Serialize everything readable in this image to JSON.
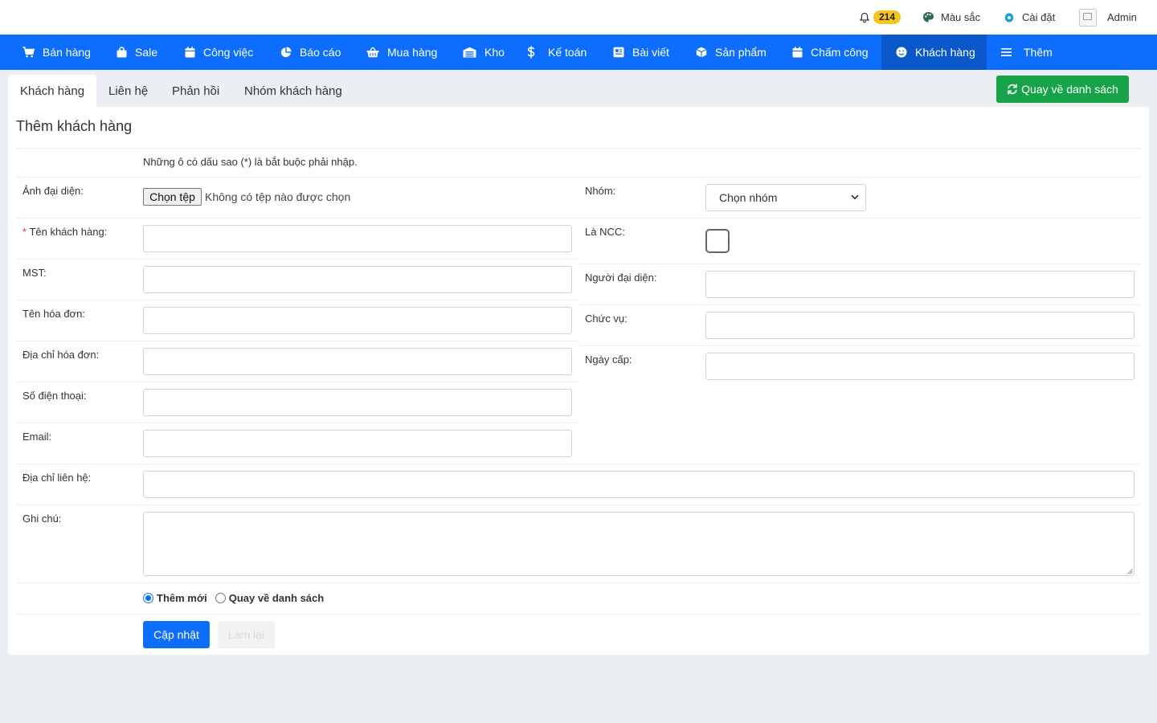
{
  "topbar": {
    "notifications_count": "214",
    "color_label": "Màu sắc",
    "settings_label": "Cài đặt",
    "avatar_alt": "lo",
    "user_name": "Admin"
  },
  "nav": {
    "items": [
      {
        "label": "Bán hàng",
        "icon": "cart-icon"
      },
      {
        "label": "Sale",
        "icon": "bag-icon"
      },
      {
        "label": "Công việc",
        "icon": "calendar-icon"
      },
      {
        "label": "Báo cáo",
        "icon": "pie-chart-icon"
      },
      {
        "label": "Mua hàng",
        "icon": "basket-icon"
      },
      {
        "label": "Kho",
        "icon": "warehouse-icon"
      },
      {
        "label": "Kế toán",
        "icon": "dollar-icon"
      },
      {
        "label": "Bài viết",
        "icon": "book-icon"
      },
      {
        "label": "Sản phẩm",
        "icon": "box-icon"
      },
      {
        "label": "Chấm công",
        "icon": "calendar-icon"
      },
      {
        "label": "Khách hàng",
        "icon": "smile-icon",
        "active": true
      },
      {
        "label": "Thêm",
        "icon": "menu-icon"
      }
    ]
  },
  "tabs": {
    "items": [
      {
        "label": "Khách hàng",
        "active": true
      },
      {
        "label": "Liên hệ"
      },
      {
        "label": "Phản hồi"
      },
      {
        "label": "Nhóm khách hàng"
      }
    ],
    "back_button": "Quay về danh sách"
  },
  "form": {
    "title": "Thêm khách hàng",
    "note": "Những ô có dấu sao (*) là bắt buộc phải nhập.",
    "avatar_label": "Ảnh đại diện:",
    "file_button": "Chọn tệp",
    "file_status": "Không có tệp nào được chọn",
    "group_label": "Nhóm:",
    "group_selected": "Chọn nhóm",
    "required_mark": "*",
    "name_label": " Tên khách hàng:",
    "is_supplier_label": "Là NCC:",
    "tax_label": "MST:",
    "representative_label": "Người đại diện:",
    "invoice_name_label": "Tên hóa đơn:",
    "position_label": "Chức vụ:",
    "invoice_address_label": "Địa chỉ hóa đơn:",
    "issue_date_label": "Ngày cấp:",
    "phone_label": "Số điện thoại:",
    "email_label": "Email:",
    "contact_address_label": "Địa chỉ liên hệ:",
    "notes_label": "Ghi chú:",
    "radio_add_new": "Thêm mới",
    "radio_back_list": "Quay về danh sách",
    "submit_button": "Cập nhật",
    "reset_button": "Làm lại"
  },
  "colors": {
    "nav_bg": "#0d6efd",
    "nav_active": "#0a58ca",
    "success": "#16a34a",
    "badge": "#f5c518"
  }
}
